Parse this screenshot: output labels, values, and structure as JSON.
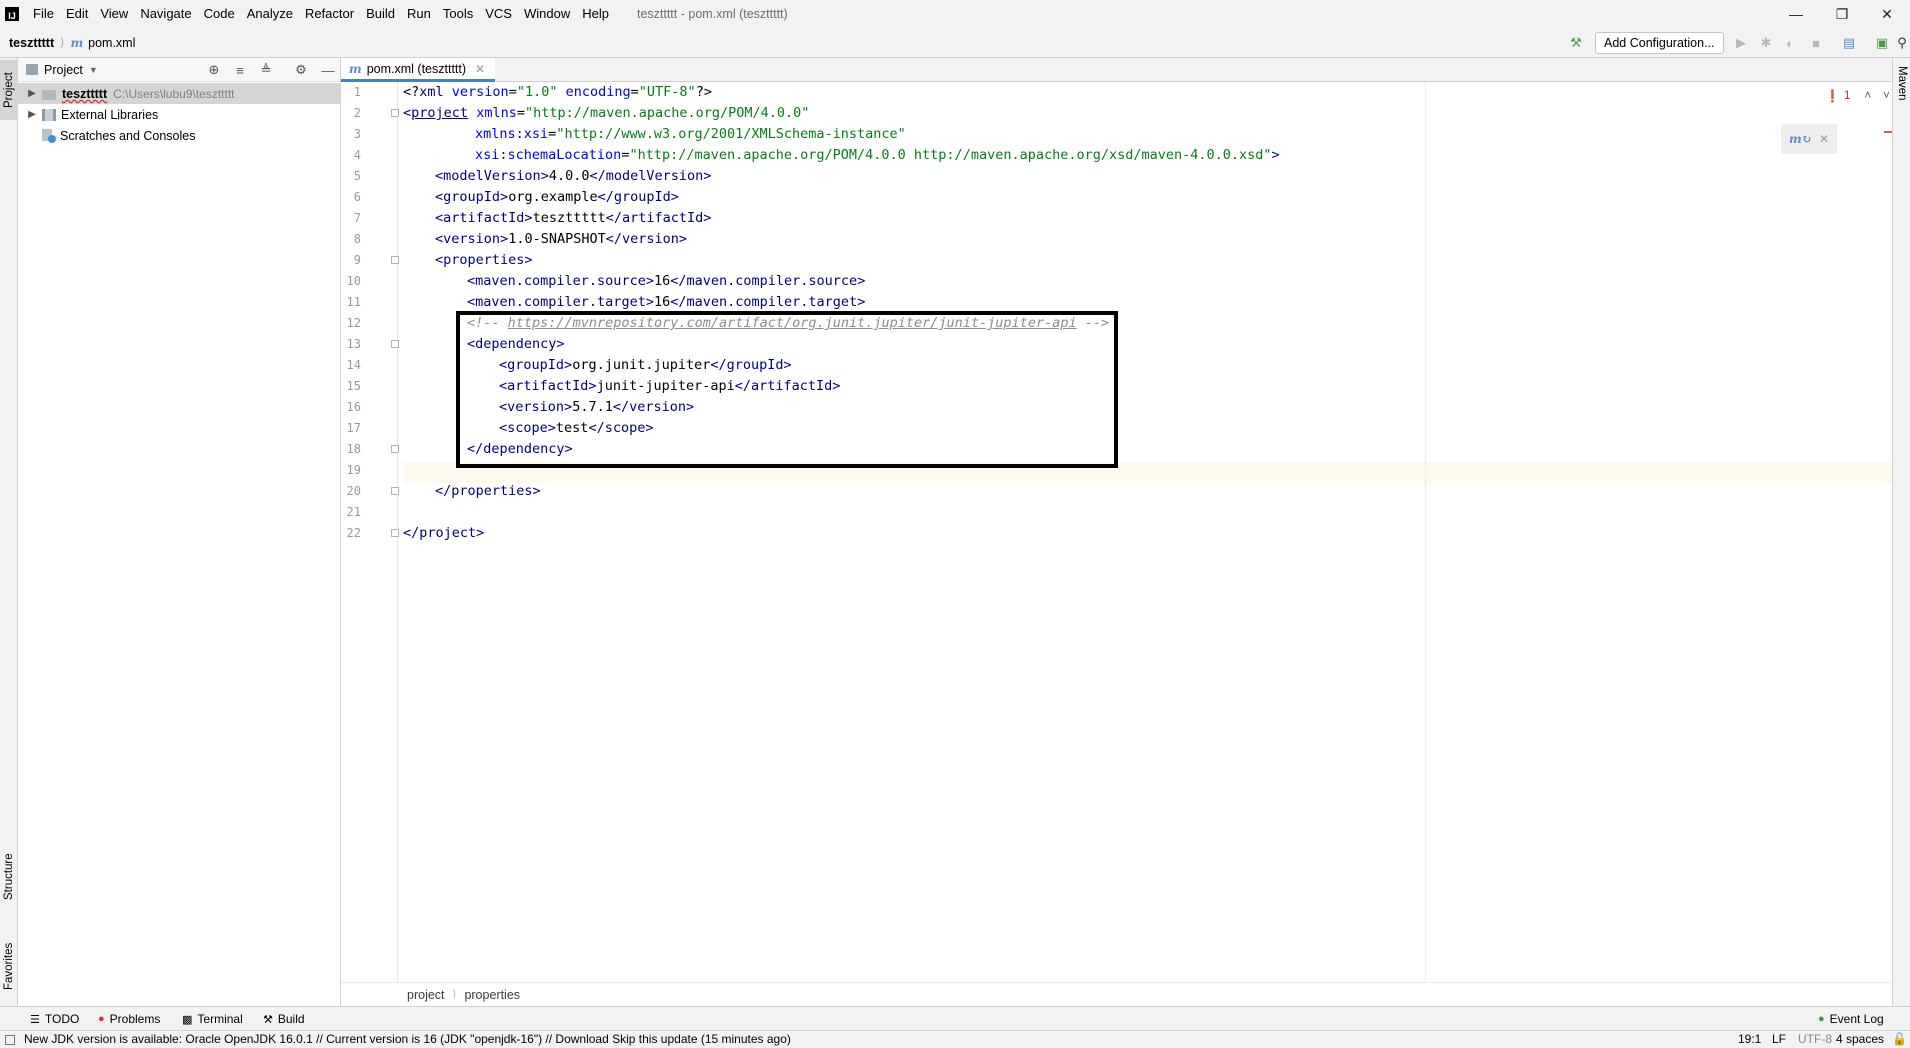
{
  "menu": {
    "logo": "IJ",
    "items": [
      "File",
      "Edit",
      "View",
      "Navigate",
      "Code",
      "Analyze",
      "Refactor",
      "Build",
      "Run",
      "Tools",
      "VCS",
      "Window",
      "Help"
    ],
    "window_title": "teszttttt - pom.xml (teszttttt)"
  },
  "navbar": {
    "project": "teszttttt",
    "file": "pom.xml",
    "add_configuration": "Add Configuration..."
  },
  "left_strip": {
    "project": "Project",
    "structure": "Structure",
    "favorites": "Favorites"
  },
  "right_strip": {
    "maven": "Maven"
  },
  "project_panel": {
    "title": "Project",
    "tree": [
      {
        "name": "teszttttt",
        "path": "C:\\Users\\lubu9\\teszttttt"
      },
      {
        "name": "External Libraries"
      },
      {
        "name": "Scratches and Consoles"
      }
    ]
  },
  "editor": {
    "tab_label": "pom.xml (teszttttt)",
    "line_numbers": [
      "1",
      "2",
      "3",
      "4",
      "5",
      "6",
      "7",
      "8",
      "9",
      "10",
      "11",
      "12",
      "13",
      "14",
      "15",
      "16",
      "17",
      "18",
      "19",
      "20",
      "21",
      "22"
    ],
    "tokens": {
      "l1_a": "<?",
      "l1_b": "xml ",
      "l1_c": "version",
      "l1_d": "=",
      "l1_e": "\"1.0\"",
      "l1_f": " ",
      "l1_g": "encoding",
      "l1_h": "=",
      "l1_i": "\"UTF-8\"",
      "l1_j": "?>",
      "l2_a": "<",
      "l2_b": "project",
      "l2_c": " ",
      "l2_d": "xmlns",
      "l2_e": "=",
      "l2_f": "\"http://maven.apache.org/POM/4.0.0\"",
      "l3_a": "xmlns:",
      "l3_b": "xsi",
      "l3_c": "=",
      "l3_d": "\"http://www.w3.org/2001/XMLSchema-instance\"",
      "l4_a": "xsi:",
      "l4_b": "schemaLocation",
      "l4_c": "=",
      "l4_d": "\"http://maven.apache.org/POM/4.0.0 http://maven.apache.org/xsd/maven-4.0.0.xsd\"",
      "l4_e": ">",
      "l5_a": "<",
      "l5_b": "modelVersion",
      "l5_c": ">",
      "l5_d": "4.0.0",
      "l5_e": "</",
      "l5_f": "modelVersion",
      "l5_g": ">",
      "l6_a": "<",
      "l6_b": "groupId",
      "l6_c": ">",
      "l6_d": "org.example",
      "l6_e": "</",
      "l6_f": "groupId",
      "l6_g": ">",
      "l7_a": "<",
      "l7_b": "artifactId",
      "l7_c": ">",
      "l7_d": "teszttttt",
      "l7_e": "</",
      "l7_f": "artifactId",
      "l7_g": ">",
      "l8_a": "<",
      "l8_b": "version",
      "l8_c": ">",
      "l8_d": "1.0-SNAPSHOT",
      "l8_e": "</",
      "l8_f": "version",
      "l8_g": ">",
      "l9_a": "<",
      "l9_b": "properties",
      "l9_c": ">",
      "l10_a": "<",
      "l10_b": "maven.compiler.source",
      "l10_c": ">",
      "l10_d": "16",
      "l10_e": "</",
      "l10_f": "maven.compiler.source",
      "l10_g": ">",
      "l11_a": "<",
      "l11_b": "maven.compiler.target",
      "l11_c": ">",
      "l11_d": "16",
      "l11_e": "</",
      "l11_f": "maven.compiler.target",
      "l11_g": ">",
      "l12_a": "<!-- ",
      "l12_b": "https://mvnrepository.com/artifact/org.junit.jupiter/junit-jupiter-api",
      "l12_c": " -->",
      "l13_a": "<",
      "l13_b": "dependency",
      "l13_c": ">",
      "l14_a": "<",
      "l14_b": "groupId",
      "l14_c": ">",
      "l14_d": "org.junit.jupiter",
      "l14_e": "</",
      "l14_f": "groupId",
      "l14_g": ">",
      "l15_a": "<",
      "l15_b": "artifactId",
      "l15_c": ">",
      "l15_d": "junit-jupiter-api",
      "l15_e": "</",
      "l15_f": "artifactId",
      "l15_g": ">",
      "l16_a": "<",
      "l16_b": "version",
      "l16_c": ">",
      "l16_d": "5.7.1",
      "l16_e": "</",
      "l16_f": "version",
      "l16_g": ">",
      "l17_a": "<",
      "l17_b": "scope",
      "l17_c": ">",
      "l17_d": "test",
      "l17_e": "</",
      "l17_f": "scope",
      "l17_g": ">",
      "l18_a": "</",
      "l18_b": "dependency",
      "l18_c": ">",
      "l20_a": "</",
      "l20_b": "properties",
      "l20_c": ">",
      "l22_a": "</",
      "l22_b": "project",
      "l22_c": ">"
    },
    "error_count": "1",
    "breadcrumb": [
      "project",
      "properties"
    ]
  },
  "bottom_tools": {
    "todo": "TODO",
    "problems": "Problems",
    "terminal": "Terminal",
    "build": "Build",
    "event_log": "Event Log"
  },
  "status": {
    "message": "New JDK version is available: Oracle OpenJDK 16.0.1 // Current version is 16 (JDK \"openjdk-16\") // Download   Skip this update (15 minutes ago)",
    "position": "19:1",
    "line_sep": "LF",
    "encoding": "UTF-8",
    "indent": "4 spaces"
  }
}
